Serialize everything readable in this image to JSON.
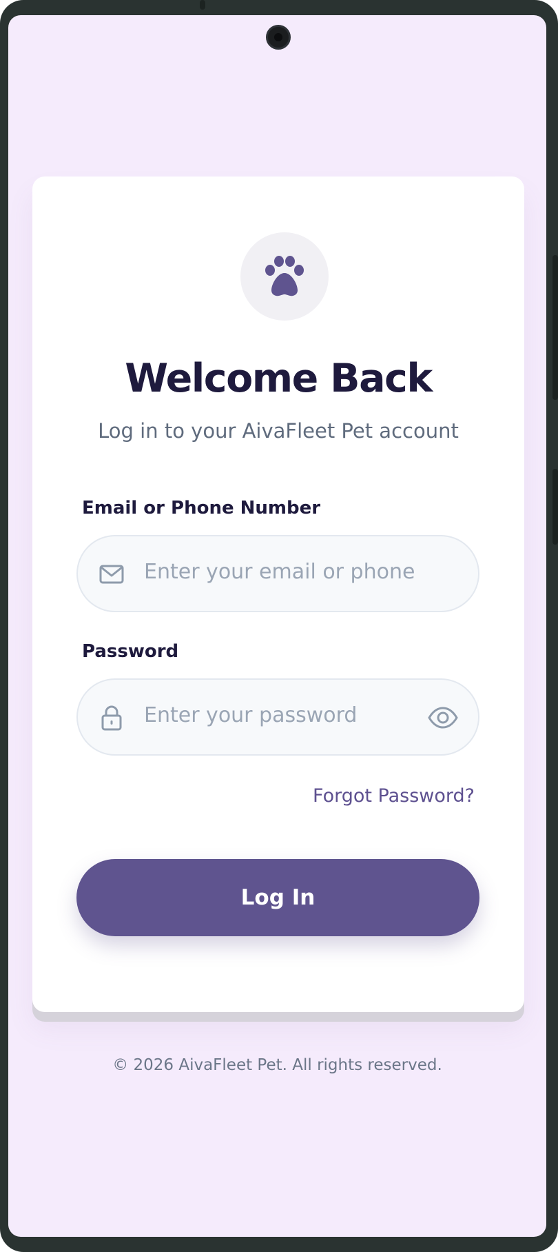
{
  "login": {
    "title": "Welcome Back",
    "subtitle": "Log in to your AivaFleet Pet account",
    "email": {
      "label": "Email or Phone Number",
      "placeholder": "Enter your email or phone",
      "value": ""
    },
    "password": {
      "label": "Password",
      "placeholder": "Enter your password",
      "value": ""
    },
    "forgot_link": "Forgot Password?",
    "submit_label": "Log In"
  },
  "footer": {
    "copyright": "© 2026 AivaFleet Pet. All rights reserved."
  },
  "icons": {
    "logo": "paw-icon",
    "email": "mail-icon",
    "password": "lock-icon",
    "toggle": "eye-icon"
  },
  "colors": {
    "primary": "#5f548f",
    "background": "#f5ebfc",
    "heading": "#1e1a3d",
    "muted": "#5f6b7d"
  }
}
